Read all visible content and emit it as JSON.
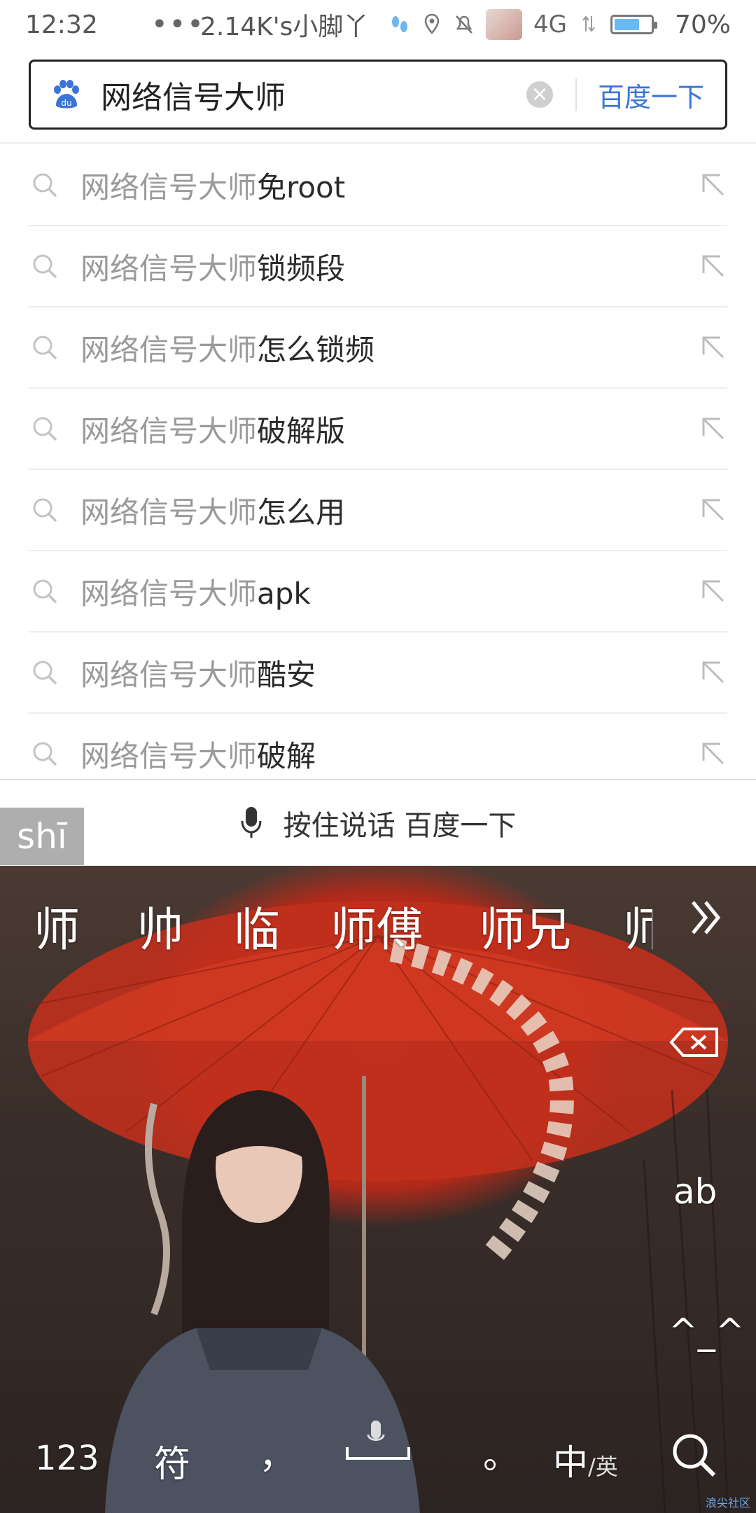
{
  "status_bar": {
    "time": "12:32",
    "dots": "•••",
    "speed_text": "2.14K's小脚丫",
    "network": "4G",
    "battery_percent": 70,
    "battery_text": "70%"
  },
  "search": {
    "query": "网络信号大师",
    "clear_icon": "clear-circle-icon",
    "button_label": "百度一下"
  },
  "suggestions": [
    {
      "prefix": "网络信号大师",
      "suffix": "免root"
    },
    {
      "prefix": "网络信号大师",
      "suffix": "锁频段"
    },
    {
      "prefix": "网络信号大师",
      "suffix": "怎么锁频"
    },
    {
      "prefix": "网络信号大师",
      "suffix": "破解版"
    },
    {
      "prefix": "网络信号大师",
      "suffix": "怎么用"
    },
    {
      "prefix": "网络信号大师",
      "suffix": "apk"
    },
    {
      "prefix": "网络信号大师",
      "suffix": "酷安"
    },
    {
      "prefix": "网络信号大师",
      "suffix": "破解"
    }
  ],
  "voice_bar": {
    "label": "按住说话 百度一下"
  },
  "keyboard": {
    "pinyin": "shī",
    "candidates": [
      "师",
      "帅",
      "临",
      "师傅",
      "师兄",
      "师"
    ],
    "keys": {
      "ab": "ab",
      "emoticon": "^_^",
      "num": "123",
      "symbol": "符",
      "comma": "，",
      "period": "。",
      "lang_main": "中",
      "lang_sep": "/",
      "lang_alt": "英"
    },
    "watermark": "浪尖社区"
  },
  "colors": {
    "accent_blue": "#3a74d6",
    "suggestion_gray": "#9a9a9a",
    "suggestion_dark": "#2a2a2a"
  }
}
